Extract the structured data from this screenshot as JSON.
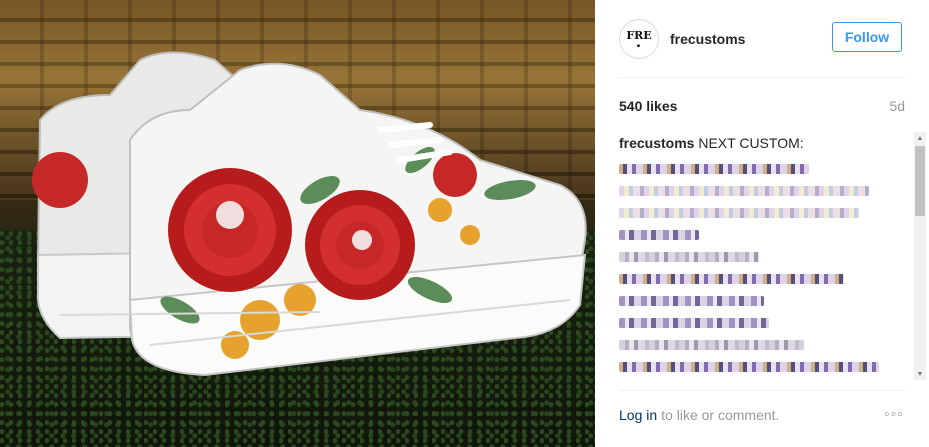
{
  "post": {
    "image_alt": "Custom white sneakers with embroidered red roses",
    "account": {
      "avatar_text": "FRE",
      "avatar_sub": "▪",
      "username": "frecustoms"
    },
    "follow_label": "Follow",
    "likes": "540 likes",
    "age": "5d",
    "caption": {
      "user": "frecustoms",
      "text": "NEXT CUSTOM:"
    },
    "blurred_line_count": 10,
    "login": {
      "link": "Log in",
      "rest": "to like or comment."
    },
    "more_label": "◦◦◦",
    "colors": {
      "accent": "#3897f0",
      "link": "#003569",
      "muted": "#999999",
      "text": "#262626"
    }
  }
}
